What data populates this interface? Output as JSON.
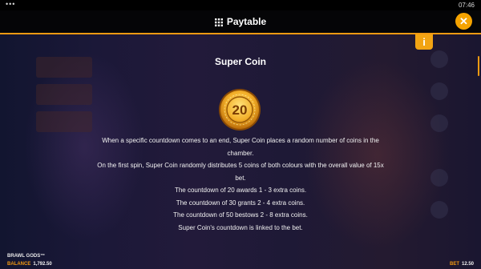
{
  "status_bar": {
    "dots": "•••",
    "time": "07:46"
  },
  "header": {
    "title": "Paytable",
    "close_label": "✕"
  },
  "info_button": {
    "label": "i"
  },
  "section": {
    "title": "Super Coin",
    "coin_value": "20",
    "lines": [
      "When a specific countdown comes to an end, Super Coin places a random number of coins in the chamber.",
      "On the first spin, Super Coin randomly distributes 5 coins of both colours with the overall value of 15x bet.",
      "The countdown of 20 awards 1 - 3 extra coins.",
      "The countdown of 30 grants 2 - 4 extra coins.",
      "The countdown of 50 bestows 2 - 8 extra coins.",
      "Super Coin's countdown is linked to the bet."
    ]
  },
  "footer": {
    "game_name": "BRAWL GODS™",
    "balance_label": "BALANCE",
    "balance_value": "1,792.50",
    "bet_label": "BET",
    "bet_value": "12.50"
  },
  "colors": {
    "accent": "#f29a12",
    "close_button": "#f5a300",
    "background": "#0c0f22"
  },
  "icons": {
    "menu": "grid-icon",
    "close": "close-icon",
    "info": "info-icon"
  }
}
